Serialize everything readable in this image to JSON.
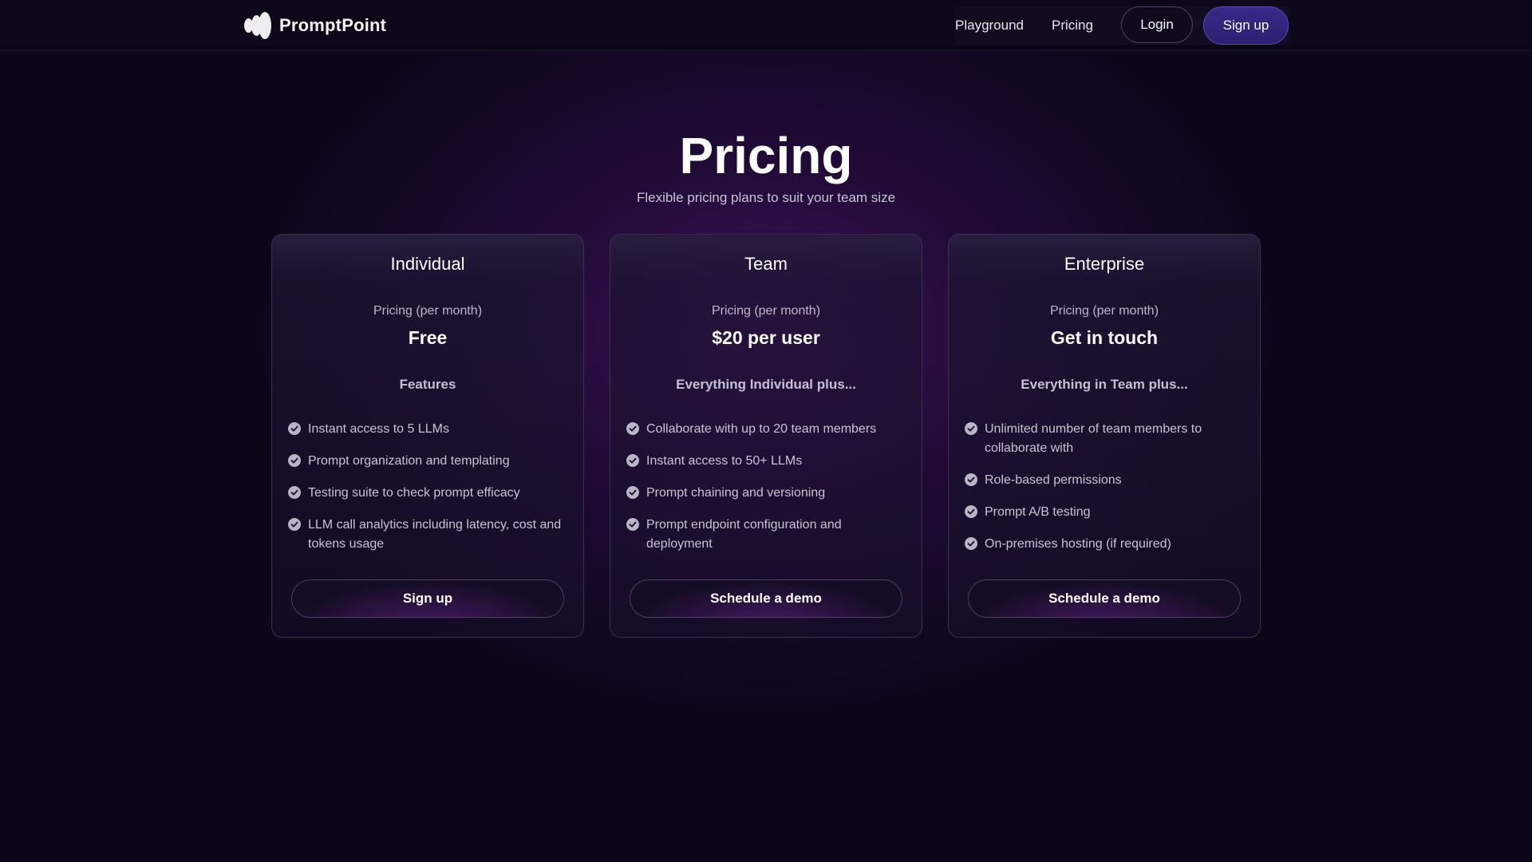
{
  "header": {
    "brand": "PromptPoint",
    "nav": {
      "playground": "Playground",
      "pricing": "Pricing",
      "login": "Login",
      "signup": "Sign up"
    }
  },
  "hero": {
    "title": "Pricing",
    "subtitle": "Flexible pricing plans to suit your team size"
  },
  "plans": [
    {
      "name": "Individual",
      "price_label": "Pricing (per month)",
      "price": "Free",
      "features_title": "Features",
      "features": [
        "Instant access to 5 LLMs",
        "Prompt organization and templating",
        "Testing suite to check prompt efficacy",
        "LLM call analytics including latency, cost and tokens usage"
      ],
      "button": "Sign up"
    },
    {
      "name": "Team",
      "price_label": "Pricing (per month)",
      "price": "$20 per user",
      "features_title": "Everything Individual plus...",
      "features": [
        "Collaborate with up to 20 team members",
        "Instant access to 50+ LLMs",
        "Prompt chaining and versioning",
        "Prompt endpoint configuration and deployment"
      ],
      "button": "Schedule a demo"
    },
    {
      "name": "Enterprise",
      "price_label": "Pricing (per month)",
      "price": "Get in touch",
      "features_title": "Everything in Team plus...",
      "features": [
        "Unlimited number of team members to collaborate with",
        "Role-based permissions",
        "Prompt A/B testing",
        "On-premises hosting (if required)"
      ],
      "button": "Schedule a demo"
    }
  ],
  "icons": {
    "logo": "promptpoint-logo-icon",
    "feature_check": "check-circle-icon"
  },
  "colors": {
    "background": "#0b0618",
    "accent": "#2c1f70",
    "glow": "#6e1e96"
  }
}
